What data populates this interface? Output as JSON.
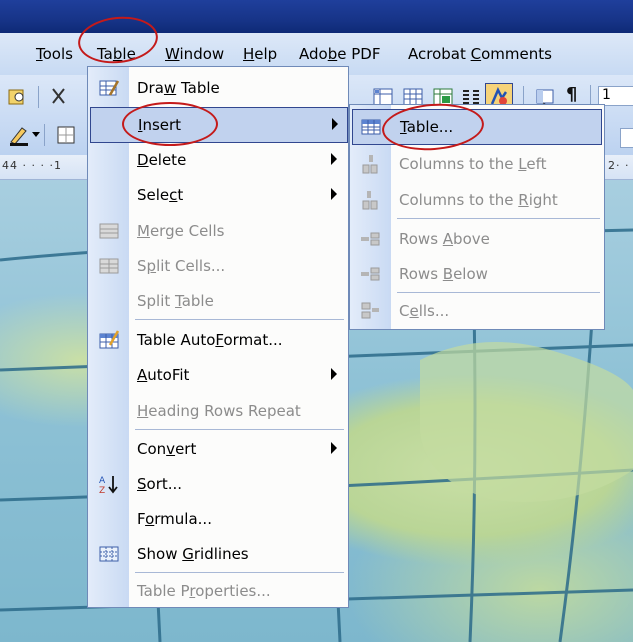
{
  "menubar": {
    "items": [
      {
        "name": "tools",
        "pre": "",
        "u": "T",
        "post": "ools"
      },
      {
        "name": "table",
        "pre": "Ta",
        "u": "b",
        "post": "le"
      },
      {
        "name": "window",
        "pre": "",
        "u": "W",
        "post": "indow"
      },
      {
        "name": "help",
        "pre": "",
        "u": "H",
        "post": "elp"
      },
      {
        "name": "adobe-pdf",
        "pre": "Ado",
        "u": "b",
        "post": "e PDF"
      },
      {
        "name": "acrobat-comments",
        "pre": "Acrobat ",
        "u": "C",
        "post": "omments"
      }
    ]
  },
  "ruler": {
    "left": "44 · · · ·1",
    "right": "2· ·"
  },
  "toolbar": {
    "pilcrow": "¶",
    "zoom_fragment": "1"
  },
  "table_menu": {
    "items": [
      {
        "name": "draw-table",
        "pre": "Dra",
        "u": "w",
        "post": " Table",
        "icon": "draw-table-icon",
        "disabled": false,
        "submenu": false
      },
      {
        "name": "insert",
        "pre": "",
        "u": "I",
        "post": "nsert",
        "icon": "",
        "disabled": false,
        "submenu": true,
        "highlighted": true
      },
      {
        "name": "delete",
        "pre": "",
        "u": "D",
        "post": "elete",
        "icon": "",
        "disabled": false,
        "submenu": true
      },
      {
        "name": "select",
        "pre": "Sele",
        "u": "c",
        "post": "t",
        "icon": "",
        "disabled": false,
        "submenu": true
      },
      {
        "name": "merge-cells",
        "pre": "",
        "u": "M",
        "post": "erge Cells",
        "icon": "merge-cells-icon",
        "disabled": true,
        "submenu": false
      },
      {
        "name": "split-cells",
        "pre": "S",
        "u": "p",
        "post": "lit Cells...",
        "icon": "split-cells-icon",
        "disabled": true,
        "submenu": false
      },
      {
        "name": "split-table",
        "pre": "Split ",
        "u": "T",
        "post": "able",
        "icon": "",
        "disabled": true,
        "submenu": false
      },
      {
        "name": "table-autoformat",
        "pre": "Table Auto",
        "u": "F",
        "post": "ormat...",
        "icon": "autoformat-icon",
        "disabled": false,
        "submenu": false
      },
      {
        "name": "autofit",
        "pre": "",
        "u": "A",
        "post": "utoFit",
        "icon": "",
        "disabled": false,
        "submenu": true
      },
      {
        "name": "heading-rows-repeat",
        "pre": "",
        "u": "H",
        "post": "eading Rows Repeat",
        "icon": "",
        "disabled": true,
        "submenu": false
      },
      {
        "name": "convert",
        "pre": "Con",
        "u": "v",
        "post": "ert",
        "icon": "",
        "disabled": false,
        "submenu": true
      },
      {
        "name": "sort",
        "pre": "",
        "u": "S",
        "post": "ort...",
        "icon": "sort-icon",
        "disabled": false,
        "submenu": false
      },
      {
        "name": "formula",
        "pre": "F",
        "u": "o",
        "post": "rmula...",
        "icon": "",
        "disabled": false,
        "submenu": false
      },
      {
        "name": "show-gridlines",
        "pre": "Show ",
        "u": "G",
        "post": "ridlines",
        "icon": "gridlines-icon",
        "disabled": false,
        "submenu": false
      },
      {
        "name": "table-properties",
        "pre": "Table P",
        "u": "r",
        "post": "operties...",
        "icon": "",
        "disabled": true,
        "submenu": false
      }
    ]
  },
  "insert_submenu": {
    "items": [
      {
        "name": "insert-table",
        "pre": "",
        "u": "T",
        "post": "able...",
        "icon": "insert-table-icon",
        "disabled": false,
        "highlighted": true
      },
      {
        "name": "columns-left",
        "pre": "Columns to the ",
        "u": "L",
        "post": "eft",
        "icon": "columns-left-icon",
        "disabled": true
      },
      {
        "name": "columns-right",
        "pre": "Columns to the ",
        "u": "R",
        "post": "ight",
        "icon": "columns-right-icon",
        "disabled": true
      },
      {
        "name": "rows-above",
        "pre": "Rows ",
        "u": "A",
        "post": "bove",
        "icon": "rows-above-icon",
        "disabled": true
      },
      {
        "name": "rows-below",
        "pre": "Rows ",
        "u": "B",
        "post": "elow",
        "icon": "rows-below-icon",
        "disabled": true
      },
      {
        "name": "cells",
        "pre": "C",
        "u": "e",
        "post": "lls...",
        "icon": "cells-icon",
        "disabled": true
      }
    ]
  },
  "colors": {
    "annotation": "#c41a1a",
    "highlight": "#c1d2ee",
    "highlight_border": "#31478f",
    "disabled_text": "#8c8c8c"
  }
}
